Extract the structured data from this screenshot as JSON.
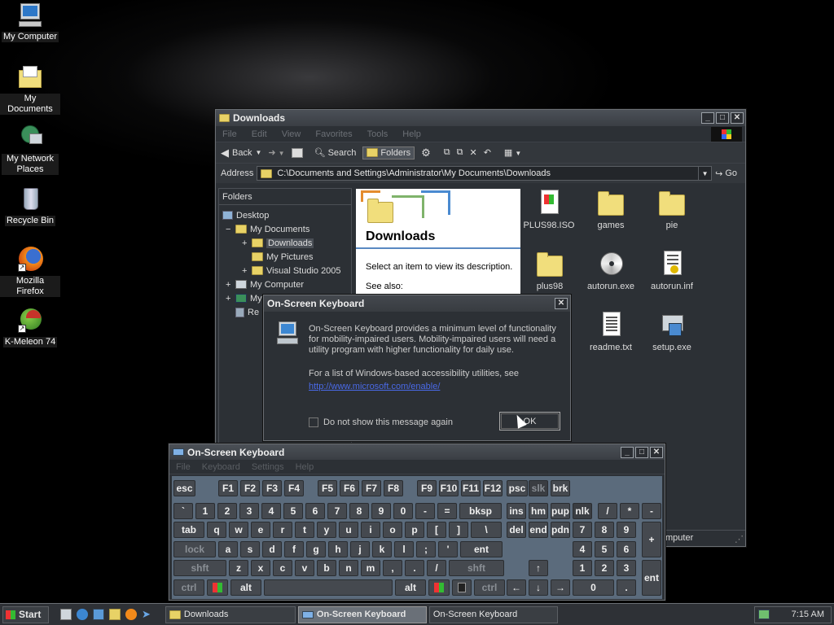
{
  "desktop": {
    "icons": [
      {
        "label": "My Computer",
        "icon": "monitor-icon"
      },
      {
        "label": "My Documents",
        "icon": "documents-folder-icon"
      },
      {
        "label": "My Network Places",
        "icon": "network-places-icon"
      },
      {
        "label": "Recycle Bin",
        "icon": "recycle-bin-icon"
      },
      {
        "label": "Mozilla Firefox",
        "icon": "firefox-icon"
      },
      {
        "label": "K-Meleon 74",
        "icon": "kmeleon-icon"
      }
    ]
  },
  "explorer": {
    "title": "Downloads",
    "menu": [
      "File",
      "Edit",
      "View",
      "Favorites",
      "Tools",
      "Help"
    ],
    "toolbar": {
      "back": "Back",
      "search": "Search",
      "folders": "Folders"
    },
    "address_label": "Address",
    "address_value": "C:\\Documents and Settings\\Administrator\\My Documents\\Downloads",
    "go": "Go",
    "folders_header": "Folders",
    "tree": [
      {
        "label": "Desktop",
        "expander": ""
      },
      {
        "label": "My Documents",
        "expander": "−"
      },
      {
        "label": "Downloads",
        "expander": "+"
      },
      {
        "label": "My Pictures",
        "expander": ""
      },
      {
        "label": "Visual Studio 2005",
        "expander": "+"
      },
      {
        "label": "My Computer",
        "expander": "+"
      },
      {
        "label": "My",
        "expander": "+"
      },
      {
        "label": "Re",
        "expander": ""
      }
    ],
    "info_title": "Downloads",
    "info_text": "Select an item to view its description.",
    "info_see_also": "See also:",
    "files": [
      {
        "name": "PLUS98.ISO",
        "icon": "iso-file-icon"
      },
      {
        "name": "games",
        "icon": "folder-icon"
      },
      {
        "name": "pie",
        "icon": "folder-icon"
      },
      {
        "name": "plus98",
        "icon": "folder-icon"
      },
      {
        "name": "autorun.exe",
        "icon": "cd-icon"
      },
      {
        "name": "autorun.inf",
        "icon": "settings-file-icon"
      },
      {
        "name": "readme.txt",
        "icon": "text-file-icon"
      },
      {
        "name": "setup.exe",
        "icon": "setup-icon"
      }
    ],
    "status_partial": "mputer"
  },
  "dialog": {
    "title": "On-Screen Keyboard",
    "text1": "On-Screen Keyboard provides a minimum level of functionality for mobility-impaired users. Mobility-impaired users will need a utility program with higher functionality for daily use.",
    "text2": "For a list of Windows-based accessibility utilities, see",
    "link": "http://www.microsoft.com/enable/",
    "checkbox_label": "Do not show this message again",
    "ok": "OK"
  },
  "osk": {
    "title": "On-Screen Keyboard",
    "menu": [
      "File",
      "Keyboard",
      "Settings",
      "Help"
    ],
    "rows": {
      "r1": [
        "esc",
        "F1",
        "F2",
        "F3",
        "F4",
        "F5",
        "F6",
        "F7",
        "F8",
        "F9",
        "F10",
        "F11",
        "F12",
        "psc",
        "slk",
        "brk"
      ],
      "r2": [
        "`",
        "1",
        "2",
        "3",
        "4",
        "5",
        "6",
        "7",
        "8",
        "9",
        "0",
        "-",
        "=",
        "bksp",
        "ins",
        "hm",
        "pup",
        "nlk",
        "/",
        "*",
        "-"
      ],
      "r3": [
        "tab",
        "q",
        "w",
        "e",
        "r",
        "t",
        "y",
        "u",
        "i",
        "o",
        "p",
        "[",
        "]",
        "\\",
        "del",
        "end",
        "pdn",
        "7",
        "8",
        "9",
        "+"
      ],
      "r4": [
        "lock",
        "a",
        "s",
        "d",
        "f",
        "g",
        "h",
        "j",
        "k",
        "l",
        ";",
        "'",
        "ent",
        "4",
        "5",
        "6"
      ],
      "r5": [
        "shft",
        "z",
        "x",
        "c",
        "v",
        "b",
        "n",
        "m",
        ",",
        ".",
        "/",
        "shft",
        "↑",
        "1",
        "2",
        "3",
        "ent"
      ],
      "r6": [
        "ctrl",
        "alt",
        "alt",
        "ctrl",
        "←",
        "↓",
        "→",
        "0",
        "."
      ]
    }
  },
  "taskbar": {
    "start": "Start",
    "items": [
      "Downloads",
      "On-Screen Keyboard",
      "On-Screen Keyboard"
    ],
    "clock": "7:15 AM"
  }
}
